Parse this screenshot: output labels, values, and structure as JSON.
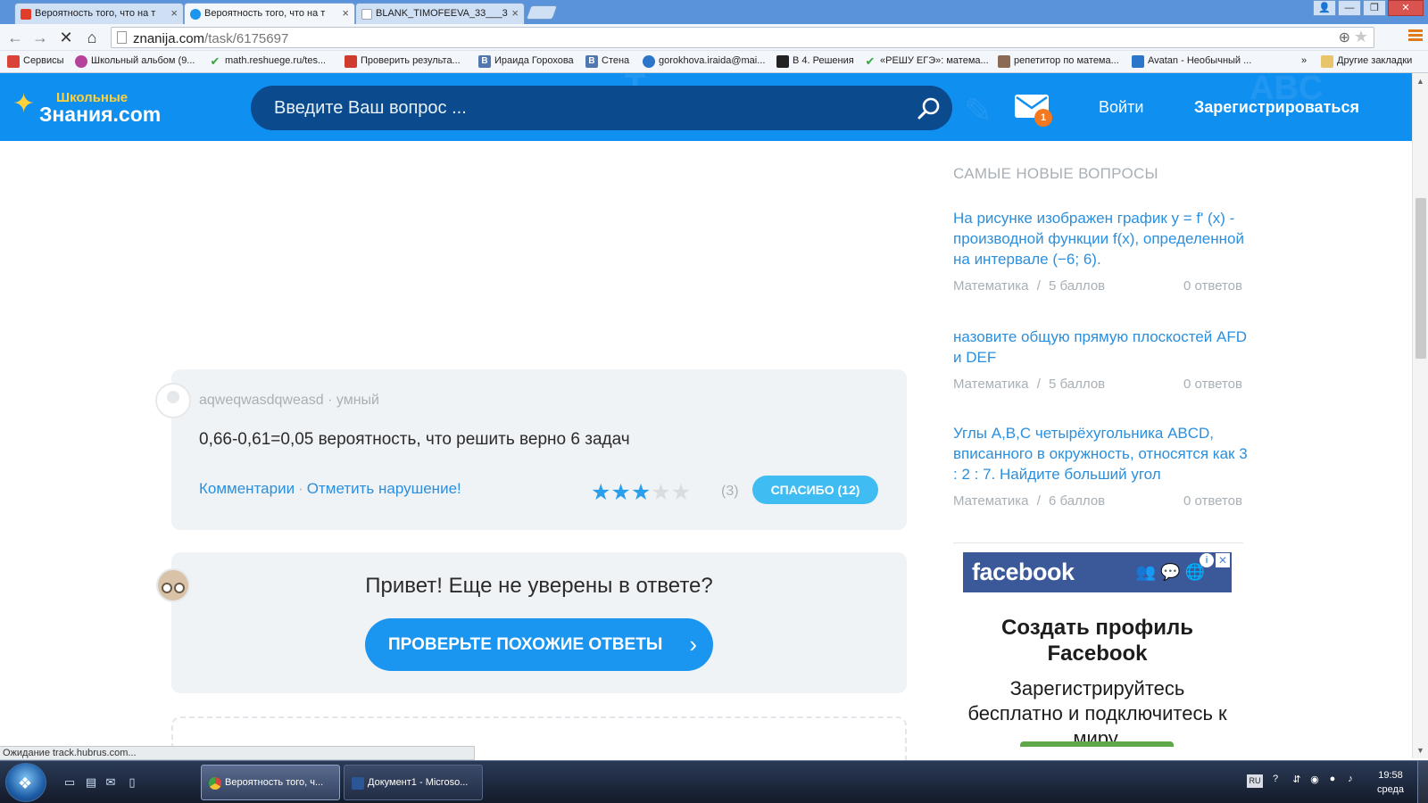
{
  "browser": {
    "tabs": [
      {
        "title": "Вероятность того, что на т",
        "favicon_color": "#e23c2a",
        "active": false
      },
      {
        "title": "Вероятность того, что на т",
        "favicon_color": "#1a95f0",
        "active": true
      },
      {
        "title": "BLANK_TIMOFEEVA_33___3",
        "favicon_color": "#9aa4ae",
        "active": false
      }
    ],
    "url_host": "znanija.com",
    "url_path": "/task/6175697",
    "bookmarks": [
      {
        "label": "Сервисы",
        "icon_color": "#d9433a"
      },
      {
        "label": "Школьный альбом (9...",
        "icon_color": "#b5439a"
      },
      {
        "label": "math.reshuege.ru/tes...",
        "icon_color": "#3aa540"
      },
      {
        "label": "Проверить результа...",
        "icon_color": "#cf3b2e"
      },
      {
        "label": "Ираида Горохова",
        "icon_color": "#5077b0",
        "icon_letter": "В"
      },
      {
        "label": "Стена",
        "icon_color": "#5077b0",
        "icon_letter": "В"
      },
      {
        "label": "gorokhova.iraida@mai...",
        "icon_color": "#2b76c9"
      },
      {
        "label": "В 4. Решения",
        "icon_color": "#222222"
      },
      {
        "label": "«РЕШУ ЕГЭ»: матема...",
        "icon_color": "#3aa540"
      },
      {
        "label": "репетитор по матема...",
        "icon_color": "#8a6a54"
      },
      {
        "label": "Avatan - Необычный ...",
        "icon_color": "#2b76c9"
      }
    ],
    "bookmarks_overflow": "»",
    "other_bookmarks": "Другие закладки",
    "status_text": "Ожидание track.hubrus.com..."
  },
  "site": {
    "logo_small": "Школьные",
    "logo_big": "Знания.com",
    "search_placeholder": "Введите Ваш вопрос ...",
    "mail_badge": "1",
    "login_label": "Войти",
    "register_label": "Зарегистрироваться",
    "brand_color": "#0f8ff0"
  },
  "answer": {
    "user": "aqweqwasdqweasd",
    "rank": "умный",
    "text": "0,66-0,61=0,05 вероятность, что решить верно 6 задач",
    "comments_label": "Комментарии",
    "report_label": "Отметить нарушение!",
    "rating_stars": 3,
    "rating_max": 5,
    "rating_count": "(3)",
    "thanks_label": "СПАСИБО (12)"
  },
  "hint": {
    "title": "Привет! Еще не уверены в ответе?",
    "button_label": "ПРОВЕРЬТЕ ПОХОЖИЕ ОТВЕТЫ"
  },
  "sidebar": {
    "title": "САМЫЕ НОВЫЕ ВОПРОСЫ",
    "questions": [
      {
        "text": "На рисунке изображен график y = f' (x) - производной функции f(x), определенной на интервале (−6; 6).",
        "subject": "Математика",
        "points": "5 баллов",
        "answers": "0 ответов"
      },
      {
        "text": "назовите общую прямую плоскостей AFD и DEF",
        "subject": "Математика",
        "points": "5 баллов",
        "answers": "0 ответов"
      },
      {
        "text": "Углы A,B,C четырёхугольника ABCD, вписанного в окружность, относятся как 3 : 2 : 7. Найдите больший угол",
        "subject": "Математика",
        "points": "6 баллов",
        "answers": "0 ответов"
      }
    ],
    "meta_separator": "/"
  },
  "ad": {
    "brand": "facebook",
    "headline": "Создать профиль Facebook",
    "body": "Зарегистрируйтесь бесплатно и подключитесь к миру.",
    "close": "✕",
    "info": "i"
  },
  "taskbar": {
    "buttons": [
      {
        "label": "Вероятность того, ч...",
        "active": true
      },
      {
        "label": "Документ1 - Microso...",
        "active": false
      }
    ],
    "lang": "RU",
    "time": "19:58",
    "day": "среда"
  }
}
